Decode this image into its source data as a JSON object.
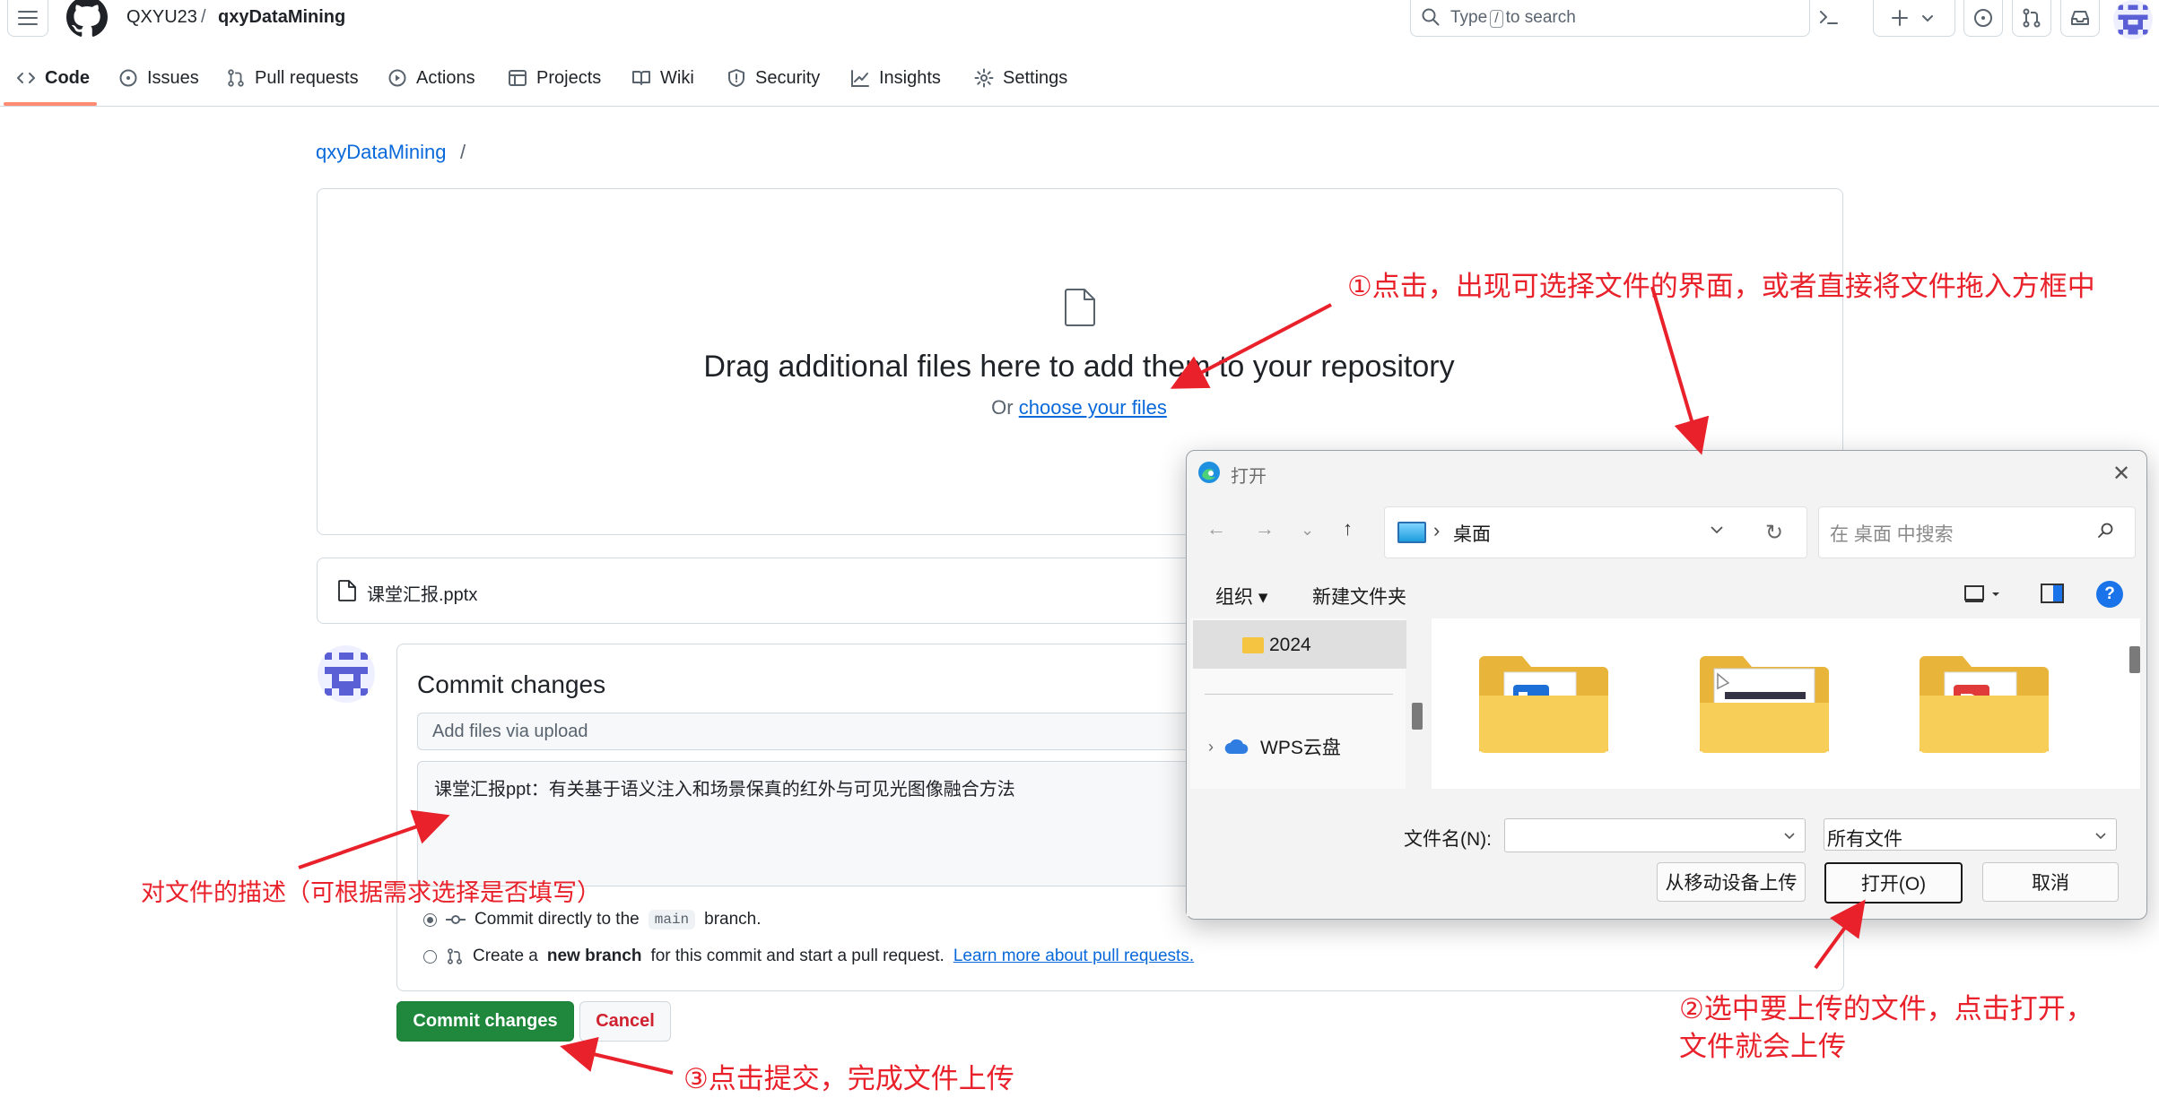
{
  "header": {
    "owner": "QXYU23",
    "separator": "/",
    "repo": "qxyDataMining",
    "search_prefix": "Type",
    "search_key": "/",
    "search_suffix": "to search"
  },
  "repo_nav": [
    {
      "label": "Code",
      "icon": "code-icon",
      "selected": true
    },
    {
      "label": "Issues",
      "icon": "issue-icon"
    },
    {
      "label": "Pull requests",
      "icon": "pull-request-icon"
    },
    {
      "label": "Actions",
      "icon": "play-icon"
    },
    {
      "label": "Projects",
      "icon": "table-icon"
    },
    {
      "label": "Wiki",
      "icon": "book-icon"
    },
    {
      "label": "Security",
      "icon": "shield-icon"
    },
    {
      "label": "Insights",
      "icon": "graph-icon"
    },
    {
      "label": "Settings",
      "icon": "gear-icon"
    }
  ],
  "path": {
    "repo": "qxyDataMining",
    "separator": "/"
  },
  "dropzone": {
    "title": "Drag additional files here to add them to your repository",
    "or_text": "Or",
    "choose_link": "choose your files"
  },
  "uploaded_file": "课堂汇报.pptx",
  "commit": {
    "title": "Commit changes",
    "summary_placeholder": "Add files via upload",
    "description": "课堂汇报ppt：有关基于语义注入和场景保真的红外与可见光图像融合方法",
    "option_direct_pre": "Commit directly to the",
    "option_direct_branch": "main",
    "option_direct_post": "branch.",
    "option_new_pre": "Create a",
    "option_new_bold": "new branch",
    "option_new_post": "for this commit and start a pull request.",
    "option_new_link": "Learn more about pull requests.",
    "commit_button": "Commit changes",
    "cancel_button": "Cancel"
  },
  "dialog": {
    "title": "打开",
    "address": "桌面",
    "search_placeholder": "在 桌面 中搜索",
    "organize": "组织",
    "new_folder": "新建文件夹",
    "tree_items": [
      "2024",
      "WPS云盘"
    ],
    "filename_label": "文件名(N):",
    "filename_value": "",
    "filetype": "所有文件",
    "upload_from_mobile": "从移动设备上传",
    "open_button": "打开(O)",
    "cancel_button": "取消"
  },
  "annotations": {
    "step1": "①点击，出现可选择文件的界面，或者直接将文件拖入方框中",
    "step2_line1": "②选中要上传的文件，点击打开，",
    "step2_line2": "文件就会上传",
    "step3": "③点击提交，完成文件上传",
    "desc_note": "对文件的描述（可根据需求选择是否填写）"
  },
  "colors": {
    "annotation_red": "#e8212b",
    "link_blue": "#0969da",
    "commit_green": "#1f883d",
    "tab_underline": "#fd8c73"
  }
}
